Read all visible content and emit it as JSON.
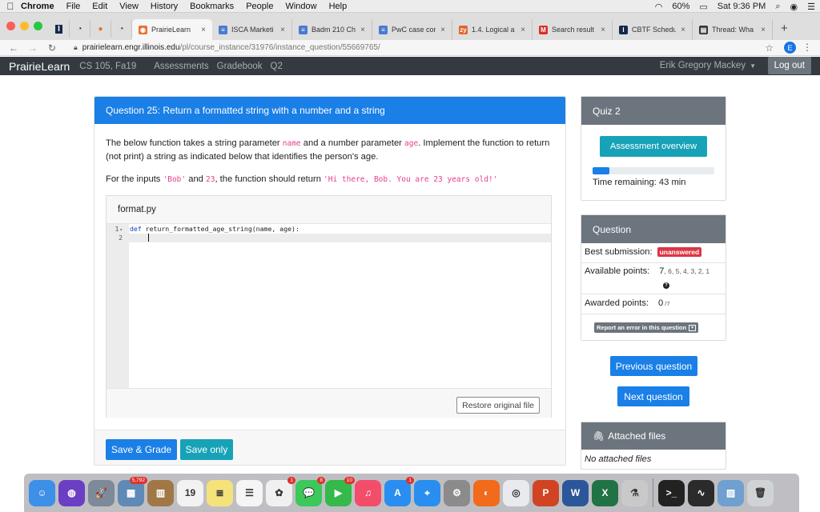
{
  "menubar": {
    "apple_icon": "apple-icon",
    "items": [
      "Chrome",
      "File",
      "Edit",
      "View",
      "History",
      "Bookmarks",
      "People",
      "Window",
      "Help"
    ],
    "battery": "60%",
    "clock": "Sat 9:36 PM"
  },
  "tabs": [
    {
      "label": "PrairieLearn",
      "color": "#e8712c",
      "glyph": "◉",
      "active": true
    },
    {
      "label": "ISCA Marketi",
      "color": "#4a7bd0",
      "glyph": "≡"
    },
    {
      "label": "Badm 210 Ch",
      "color": "#4a7bd0",
      "glyph": "≡"
    },
    {
      "label": "PwC case cor",
      "color": "#4a7bd0",
      "glyph": "≡"
    },
    {
      "label": "1.4. Logical a",
      "color": "#e0662a",
      "glyph": "zy"
    },
    {
      "label": "Search result",
      "color": "#d93025",
      "glyph": "M"
    },
    {
      "label": "CBTF Schedu",
      "color": "#13294b",
      "glyph": "I"
    },
    {
      "label": "Thread: Wha",
      "color": "#333333",
      "glyph": "▤"
    }
  ],
  "address": {
    "host": "prairielearn.engr.illinois.edu",
    "path": "/pl/course_instance/31976/instance_question/55669765/",
    "profile_initial": "E"
  },
  "navbar": {
    "brand": "PrairieLearn",
    "course": "CS 105, Fa19",
    "links": [
      "Assessments",
      "Gradebook",
      "Q2"
    ],
    "user": "Erik Gregory Mackey",
    "logout": "Log out"
  },
  "question": {
    "title": "Question 25: Return a formatted string with a number and a string",
    "p1_a": "The below function takes a string parameter ",
    "p1_code1": "name",
    "p1_b": " and a number parameter ",
    "p1_code2": "age",
    "p1_c": ". Implement the function to return (not print) a string as indicated below that identifies the person's age.",
    "p2_a": "For the inputs ",
    "p2_code1": "'Bob'",
    "p2_b": " and ",
    "p2_code2": "23",
    "p2_c": ", the function should return ",
    "p2_code3": "'Hi there, Bob. You are 23 years old!'",
    "filename": "format.py",
    "line1_num": "1",
    "line1_kw": "def",
    "line1_rest": " return_formatted_age_string(name, age):",
    "line2_num": "2",
    "restore": "Restore original file",
    "save_grade": "Save & Grade",
    "save_only": "Save only"
  },
  "quiz": {
    "title": "Quiz 2",
    "overview_button": "Assessment overview",
    "time_progress": 0.14,
    "time_remaining": "Time remaining: 43 min"
  },
  "question_info": {
    "title": "Question",
    "best_label": "Best submission:",
    "best_badge": "unanswered",
    "available_label": "Available points:",
    "available_first": "7",
    "available_rest": ", 6, 5, 4, 3, 2, 1",
    "awarded_label": "Awarded points:",
    "awarded_value": "0",
    "awarded_max": "/7",
    "report": "Report an error in this question"
  },
  "prev_question": "Previous question",
  "next_question": "Next question",
  "files": {
    "title": "Attached files",
    "empty": "No attached files"
  },
  "dock": [
    {
      "name": "finder-icon",
      "color": "#3d8fe8",
      "glyph": "☺"
    },
    {
      "name": "siri-icon",
      "color": "#6b3fc4",
      "glyph": "◍"
    },
    {
      "name": "launchpad-icon",
      "color": "#7c8a99",
      "glyph": "🚀"
    },
    {
      "name": "photo-app-icon",
      "color": "#5e8ab5",
      "glyph": "▦",
      "badge": "5,792"
    },
    {
      "name": "notebook-icon",
      "color": "#a07845",
      "glyph": "▥"
    },
    {
      "name": "calendar-icon",
      "color": "#f2f2f2",
      "glyph": "19",
      "dark": true
    },
    {
      "name": "notes-icon",
      "color": "#f5e27a",
      "glyph": "≣",
      "dark": true
    },
    {
      "name": "reminders-icon",
      "color": "#f5f5f5",
      "glyph": "☰",
      "dark": true
    },
    {
      "name": "photos-icon",
      "color": "#f0f0f0",
      "glyph": "✿",
      "dark": true,
      "badge": "1"
    },
    {
      "name": "messages-icon",
      "color": "#3cc85a",
      "glyph": "💬",
      "badge": "8"
    },
    {
      "name": "facetime-icon",
      "color": "#34b94a",
      "glyph": "▶",
      "badge": "10"
    },
    {
      "name": "music-icon",
      "color": "#f24e6a",
      "glyph": "♫"
    },
    {
      "name": "app-store-icon",
      "color": "#2a8ef0",
      "glyph": "A",
      "badge": "1"
    },
    {
      "name": "safari-icon",
      "color": "#2a8ef0",
      "glyph": "⌖"
    },
    {
      "name": "system-preferences-icon",
      "color": "#8b8b8b",
      "glyph": "⚙"
    },
    {
      "name": "firefox-icon",
      "color": "#f26a1b",
      "glyph": "◐"
    },
    {
      "name": "chrome-icon",
      "color": "#e8eaed",
      "glyph": "◎",
      "dark": true
    },
    {
      "name": "powerpoint-icon",
      "color": "#d04423",
      "glyph": "P"
    },
    {
      "name": "word-icon",
      "color": "#2b579a",
      "glyph": "W"
    },
    {
      "name": "excel-icon",
      "color": "#217346",
      "glyph": "X"
    },
    {
      "name": "scientist-icon",
      "color": "#c9c9c9",
      "glyph": "⚗",
      "dark": true
    },
    {
      "name": "terminal-icon",
      "color": "#222222",
      "glyph": ">_"
    },
    {
      "name": "activity-monitor-icon",
      "color": "#2b2b2b",
      "glyph": "∿"
    },
    {
      "name": "preview-icon",
      "color": "#6fa0cf",
      "glyph": "▨"
    },
    {
      "name": "trash-icon",
      "color": "#cfd3d6",
      "glyph": "🗑",
      "dark": true
    }
  ],
  "colors": {
    "primary": "#1a7fe6",
    "info": "#17a2b8",
    "navbar": "#343a40",
    "danger": "#dc3545",
    "secondary": "#6c757d"
  }
}
